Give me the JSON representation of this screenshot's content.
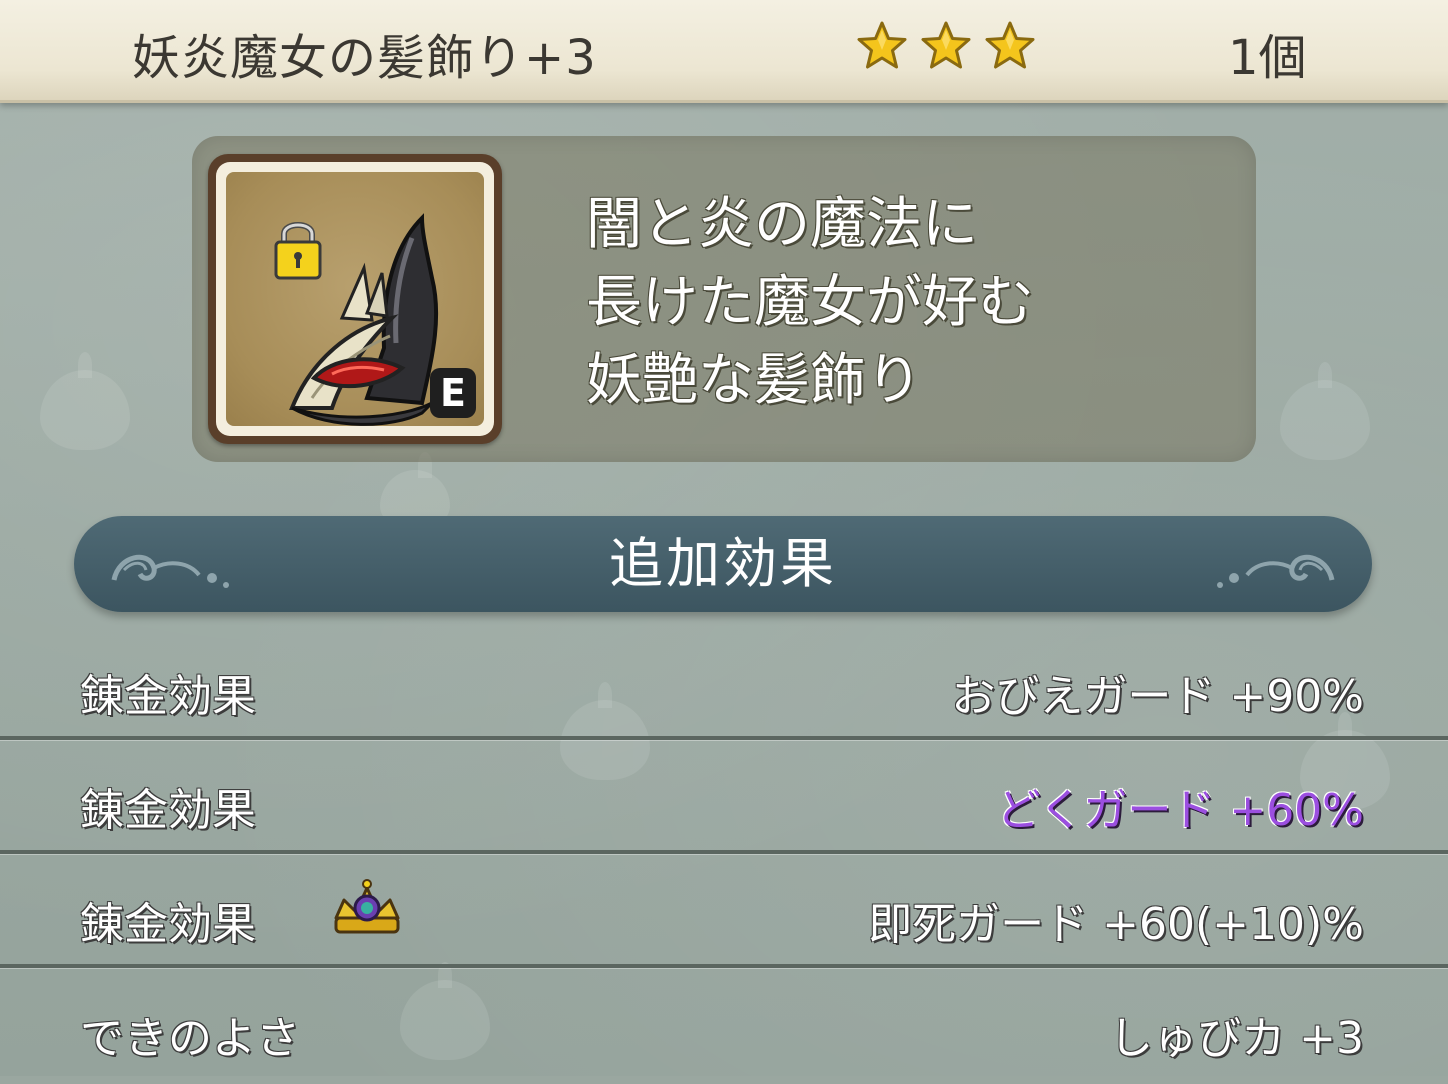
{
  "header": {
    "item_name": "妖炎魔女の髪飾り+3",
    "star_count": 3,
    "count": "1個"
  },
  "item": {
    "icon": "witch-hair-ornament-icon",
    "locked": true,
    "lock_icon": "padlock-icon",
    "equipped_badge": "E",
    "description_lines": [
      "闇と炎の魔法に",
      "長けた魔女が好む",
      "妖艶な髪飾り"
    ]
  },
  "section": {
    "title": "追加効果"
  },
  "effects": [
    {
      "label": "錬金効果",
      "value": "おびえガード +90%",
      "highlight": false
    },
    {
      "label": "錬金効果",
      "value": "どくガード +60%",
      "highlight": true,
      "highlight_color": "#9b4fe0"
    },
    {
      "label": "錬金効果",
      "value": "即死ガード +60(+10)%",
      "highlight": false,
      "badge_icon": "crown-icon"
    },
    {
      "label": "できのよさ",
      "value": "しゅびカ +3",
      "highlight": false
    }
  ],
  "colors": {
    "header_bg": "#efe9d7",
    "banner_bg": "#46606b",
    "star": "#f4c51c"
  }
}
